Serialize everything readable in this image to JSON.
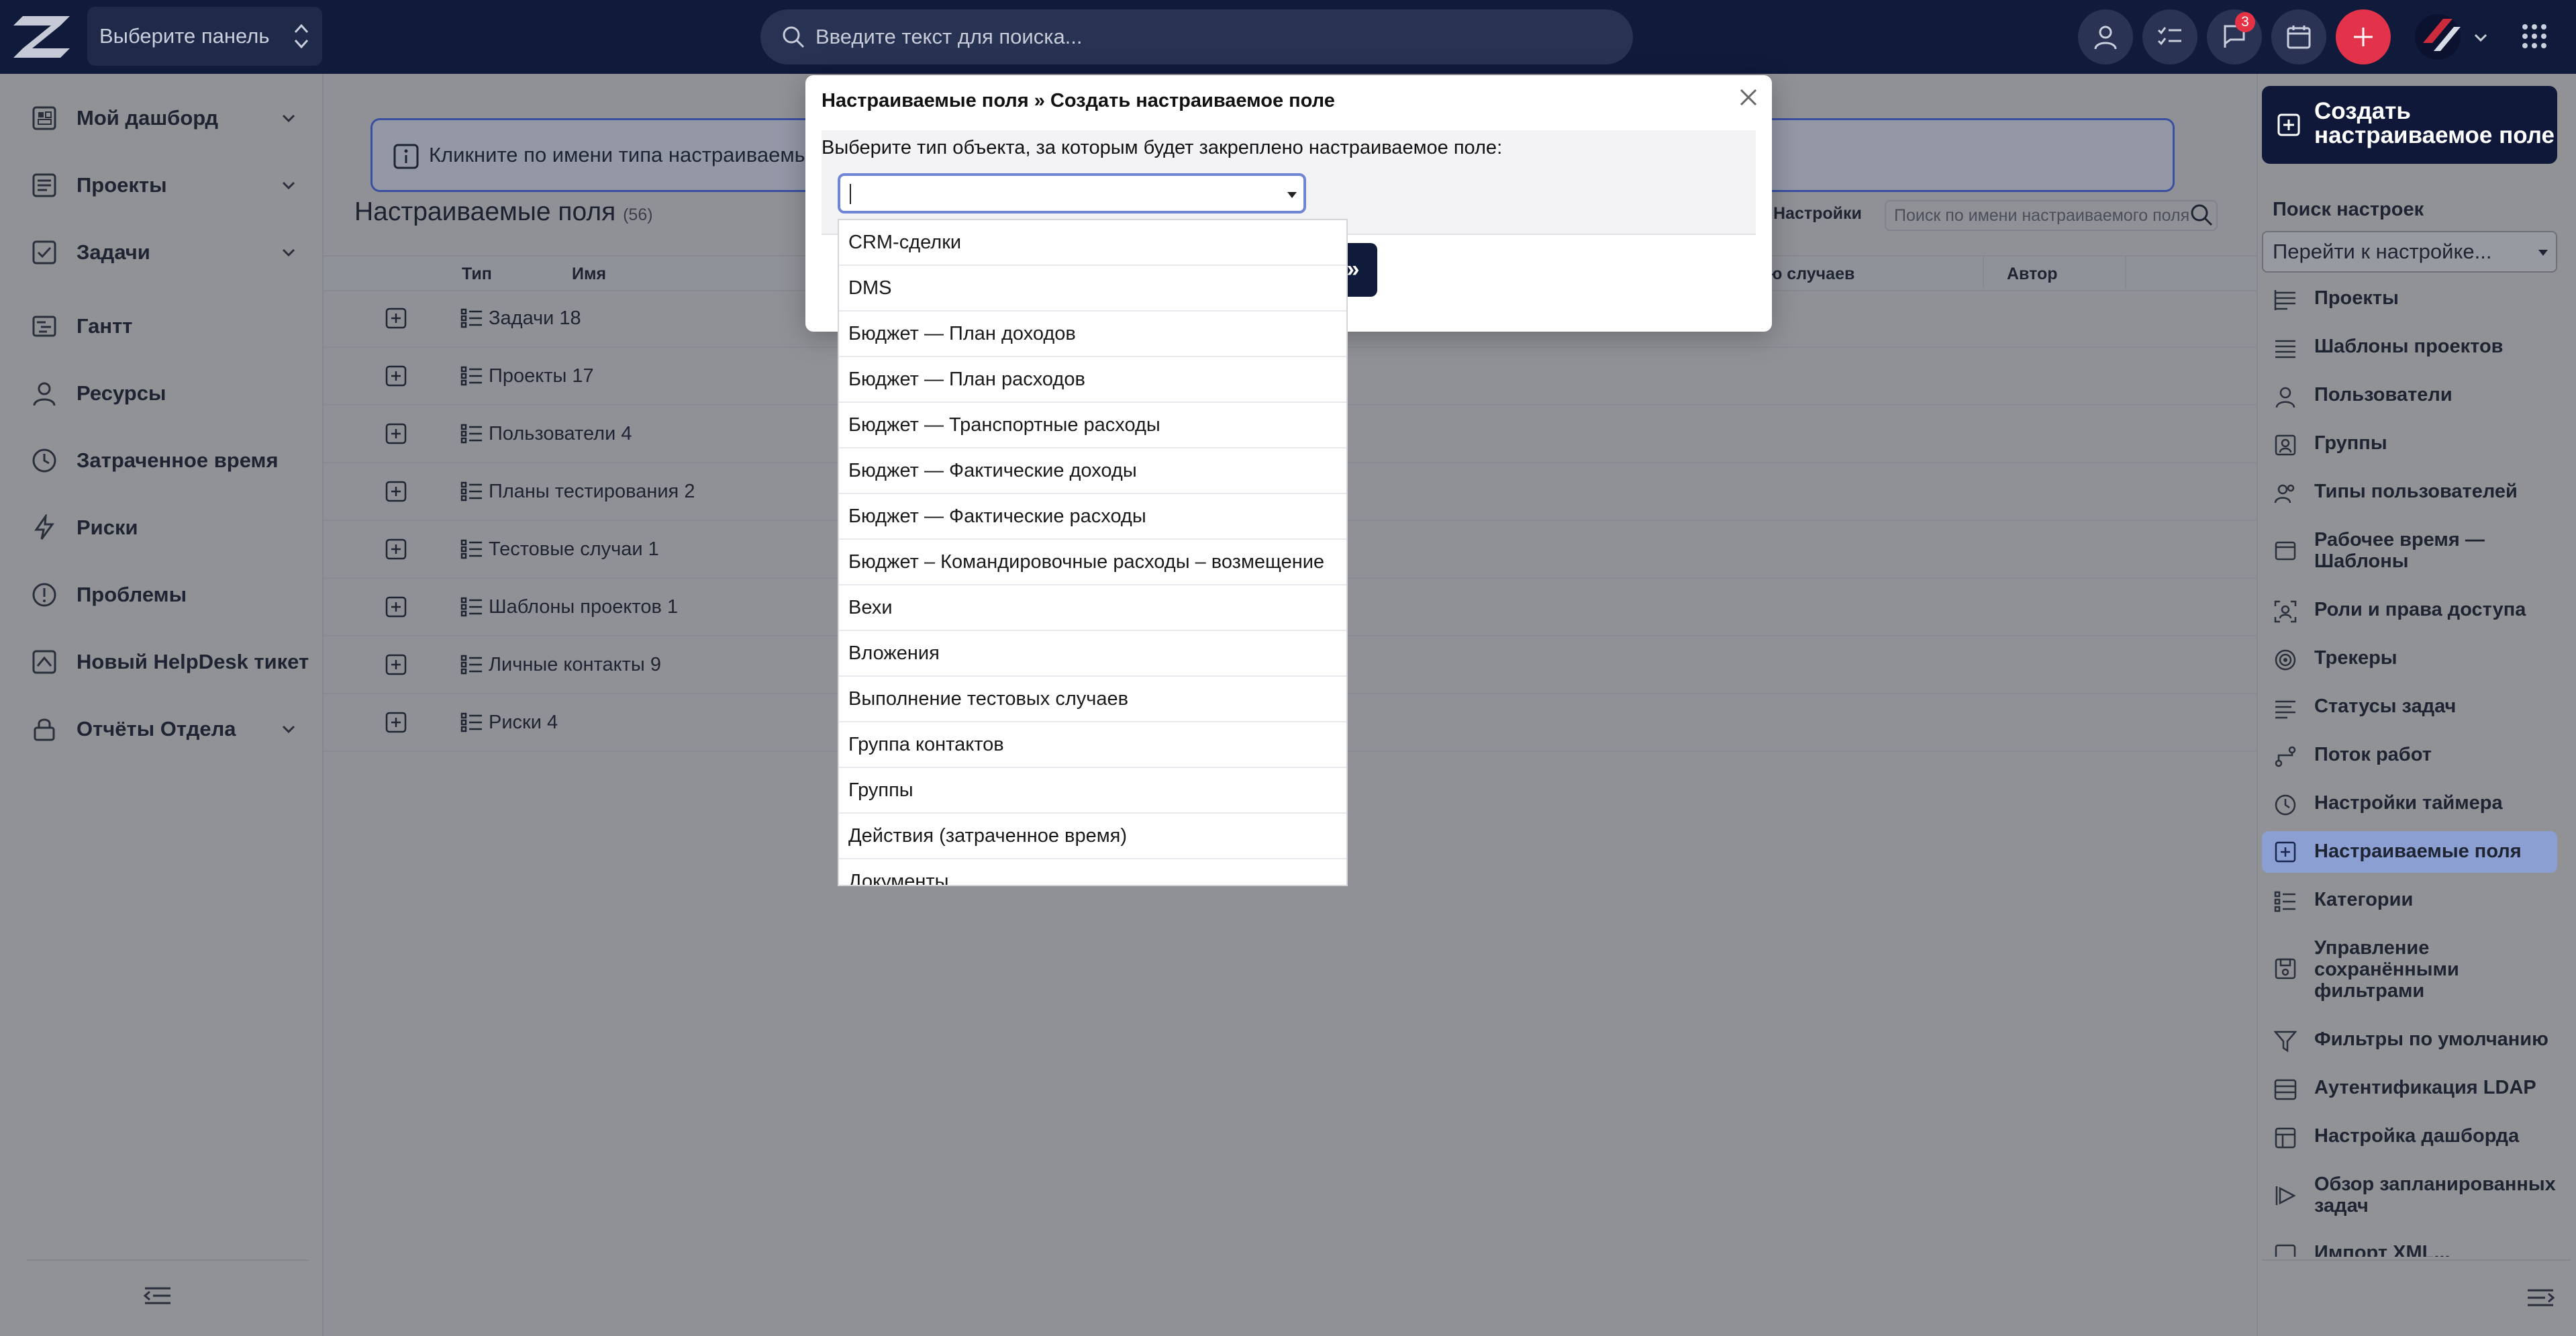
{
  "topbar": {
    "panel_select": "Выберите панель",
    "search_placeholder": "Введите текст для поиска...",
    "notifications_count": "3",
    "colors": {
      "bar": "#101a3a",
      "accent_red": "#e2334a"
    }
  },
  "sidebar": {
    "items": [
      {
        "label": "Мой дашборд",
        "icon": "dashboard-icon",
        "expandable": true
      },
      {
        "label": "Проекты",
        "icon": "projects-icon",
        "expandable": true
      },
      {
        "label": "Задачи",
        "icon": "tasks-icon",
        "expandable": true
      },
      {
        "label": "Гантт",
        "icon": "gantt-icon",
        "expandable": false
      },
      {
        "label": "Ресурсы",
        "icon": "user-icon",
        "expandable": false
      },
      {
        "label": "Затраченное время",
        "icon": "clock-icon",
        "expandable": false
      },
      {
        "label": "Риски",
        "icon": "bolt-icon",
        "expandable": false
      },
      {
        "label": "Проблемы",
        "icon": "alert-icon",
        "expandable": false
      },
      {
        "label": "Новый HelpDesk тикет",
        "icon": "ticket-icon",
        "expandable": false
      },
      {
        "label": "Отчёты Отдела",
        "icon": "lock-icon",
        "expandable": true
      }
    ]
  },
  "main": {
    "banner": "Кликните по имени типа настраиваемых",
    "title": "Настраиваемые поля",
    "count": "(56)",
    "settings_link": "Настройки",
    "search_placeholder": "Поиск по имени настраиваемого поля",
    "columns": {
      "type": "Тип",
      "name": "Имя",
      "cases": "ю случаев",
      "author": "Автор"
    },
    "rows": [
      "Задачи 18",
      "Проекты 17",
      "Пользователи 4",
      "Планы тестирования 2",
      "Тестовые случаи 1",
      "Шаблоны проектов 1",
      "Личные контакты 9",
      "Риски 4"
    ]
  },
  "right_sidebar": {
    "create_button": "Создать настраиваемое поле",
    "search_label": "Поиск настроек",
    "select_value": "Перейти к настройке...",
    "items": [
      {
        "label": "Проекты",
        "icon": "projects-icon"
      },
      {
        "label": "Шаблоны проектов",
        "icon": "template-icon"
      },
      {
        "label": "Пользователи",
        "icon": "user-icon"
      },
      {
        "label": "Группы",
        "icon": "groups-icon"
      },
      {
        "label": "Типы пользователей",
        "icon": "user-types-icon"
      },
      {
        "label": "Рабочее время — Шаблоны",
        "icon": "calendar-icon"
      },
      {
        "label": "Роли и права доступа",
        "icon": "roles-icon"
      },
      {
        "label": "Трекеры",
        "icon": "tracker-icon"
      },
      {
        "label": "Статусы задач",
        "icon": "status-icon"
      },
      {
        "label": "Поток работ",
        "icon": "workflow-icon"
      },
      {
        "label": "Настройки таймера",
        "icon": "clock-icon"
      },
      {
        "label": "Настраиваемые поля",
        "icon": "plus-square-icon",
        "active": true
      },
      {
        "label": "Категории",
        "icon": "list-icon"
      },
      {
        "label": "Управление сохранёнными фильтрами",
        "icon": "save-icon"
      },
      {
        "label": "Фильтры по умолчанию",
        "icon": "filter-icon"
      },
      {
        "label": "Аутентификация LDAP",
        "icon": "ldap-icon"
      },
      {
        "label": "Настройка дашборда",
        "icon": "dashboard-icon"
      },
      {
        "label": "Обзор запланированных задач",
        "icon": "play-icon"
      },
      {
        "label": "Импорт XML...",
        "icon": "import-icon"
      }
    ]
  },
  "modal": {
    "title": "Настраиваемые поля » Создать настраиваемое поле",
    "prompt": "Выберите тип объекта, за которым будет закреплено настраиваемое поле:",
    "next_label": "»",
    "options": [
      "CRM-сделки",
      "DMS",
      "Бюджет — План доходов",
      "Бюджет — План расходов",
      "Бюджет — Транспортные расходы",
      "Бюджет — Фактические доходы",
      "Бюджет — Фактические расходы",
      "Бюджет – Командировочные расходы – возмещение",
      "Вехи",
      "Вложения",
      "Выполнение тестовых случаев",
      "Группа контактов",
      "Группы",
      "Действия (затраченное время)",
      "Документы"
    ]
  }
}
